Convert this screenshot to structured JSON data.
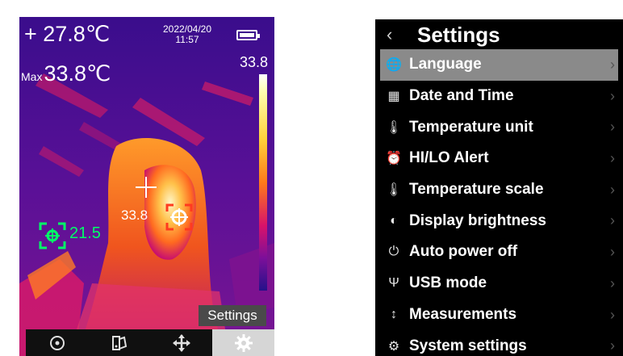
{
  "thermal": {
    "spot_temperature": "+ 27.8℃",
    "date": "2022/04/20",
    "time": "11:57",
    "max_label": "Max",
    "max_temperature": "33.8℃",
    "scale_max": "33.8",
    "center_temperature": "33.8",
    "min_temperature": "21.5",
    "battery_level": 1.0,
    "tooltip": "Settings",
    "bottom_bar": [
      {
        "icon": "target-icon",
        "active": false
      },
      {
        "icon": "palette-icon",
        "active": false
      },
      {
        "icon": "move-icon",
        "active": false
      },
      {
        "icon": "gear-icon",
        "active": true
      }
    ],
    "colors": {
      "cold": "#2a0a82",
      "hot": "#ffffff",
      "min_marker": "#00ff66",
      "max_marker": "#ff3b1f"
    }
  },
  "settings": {
    "title": "Settings",
    "back_icon": "chevron-left-icon",
    "items": [
      {
        "label": "Language",
        "icon": "globe-icon",
        "glyph": "🌐",
        "selected": true
      },
      {
        "label": "Date and Time",
        "icon": "calendar-icon",
        "glyph": "▦",
        "selected": false
      },
      {
        "label": "Temperature unit",
        "icon": "thermometer-icon",
        "glyph": "🌡",
        "selected": false
      },
      {
        "label": "HI/LO Alert",
        "icon": "alarm-icon",
        "glyph": "⏰",
        "selected": false
      },
      {
        "label": "Temperature scale",
        "icon": "thermometer-scale-icon",
        "glyph": "🌡",
        "selected": false
      },
      {
        "label": "Display brightness",
        "icon": "brightness-icon",
        "glyph": "◐",
        "selected": false
      },
      {
        "label": "Auto power off",
        "icon": "power-icon",
        "glyph": "⏻",
        "selected": false
      },
      {
        "label": "USB mode",
        "icon": "usb-icon",
        "glyph": "Ψ",
        "selected": false
      },
      {
        "label": "Measurements",
        "icon": "sliders-icon",
        "glyph": "↕",
        "selected": false
      },
      {
        "label": "System settings",
        "icon": "system-gear-icon",
        "glyph": "⚙",
        "selected": false
      }
    ],
    "chevron": "›"
  }
}
